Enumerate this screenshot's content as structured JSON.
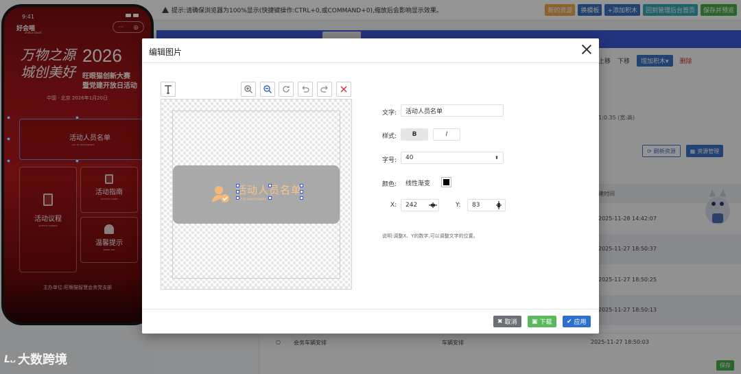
{
  "background": {
    "notice": "提示:请确保浏览器为100%显示(快捷键操作:CTRL+0,或COMMAND+0),缩放后会影响显示效果。",
    "toolbar_buttons": [
      {
        "label": "新的资源",
        "color": "#f0ad4e"
      },
      {
        "label": "换模板",
        "color": "#3a72c0"
      },
      {
        "label": "+添加积木",
        "color": "#3a72c0"
      },
      {
        "label": "回到管理后台首页",
        "color": "#38a9b7"
      },
      {
        "label": "保存并预览",
        "color": "#4cae4c"
      }
    ],
    "ops": {
      "up": "上移",
      "down": "下移",
      "add": "增加积木▾",
      "delete": "删除"
    },
    "dims": "1:0.35 (宽:高)",
    "refresh_btn": "刷新资源",
    "manage_btn": "资源管理",
    "time_header": "建时间",
    "times": [
      "2025-11-28 14:42:07",
      "2025-11-27 18:50:37",
      "2025-11-27 18:50:25",
      "2025-11-27 18:50:13"
    ],
    "last_row": {
      "name": "会务车辆安排",
      "type": "车辆安排",
      "time": "2025-11-27 18:50:03"
    },
    "save": "保存"
  },
  "phone": {
    "time": "9:41",
    "app_name": "好会喵",
    "app_sub": "zhihui cloud",
    "hero_cn": "万物之源 城创美好",
    "year": "2026",
    "line1": "旺眼猫创新大赛",
    "line2": "暨党建开放日活动",
    "location": "中国 · 北京 2026年1月20日",
    "cards": [
      {
        "title": "活动人员名单",
        "sub": "LIST OF PARTICIPANTS"
      },
      {
        "title": "活动议程",
        "sub": "ACTIVITY AGENDA"
      },
      {
        "title": "活动指南",
        "sub": "ACTIVITY GUIDE"
      },
      {
        "title": "温馨提示",
        "sub": "WARM TIPS"
      }
    ],
    "footer": "主办单位:旺眼猫智慧会务党支部"
  },
  "modal": {
    "title": "编辑图片",
    "preview_text": "活动人员名单",
    "preview_sub": "LIST OF PARTICIPANTS",
    "form": {
      "text_label": "文字:",
      "text_value": "活动人员名单",
      "style_label": "样式:",
      "bold": "B",
      "italic": "I",
      "size_label": "字号:",
      "size_value": "40",
      "color_label": "颜色:",
      "gradient": "线性渐变",
      "color_value": "#000000",
      "x_label": "X:",
      "x_value": "242",
      "y_label": "Y:",
      "y_value": "83",
      "note": "说明:调整X、Y的数字,可以调整文字的位置。"
    },
    "buttons": {
      "cancel": "取消",
      "download": "下载",
      "apply": "应用"
    }
  },
  "watermark": "大数跨境"
}
